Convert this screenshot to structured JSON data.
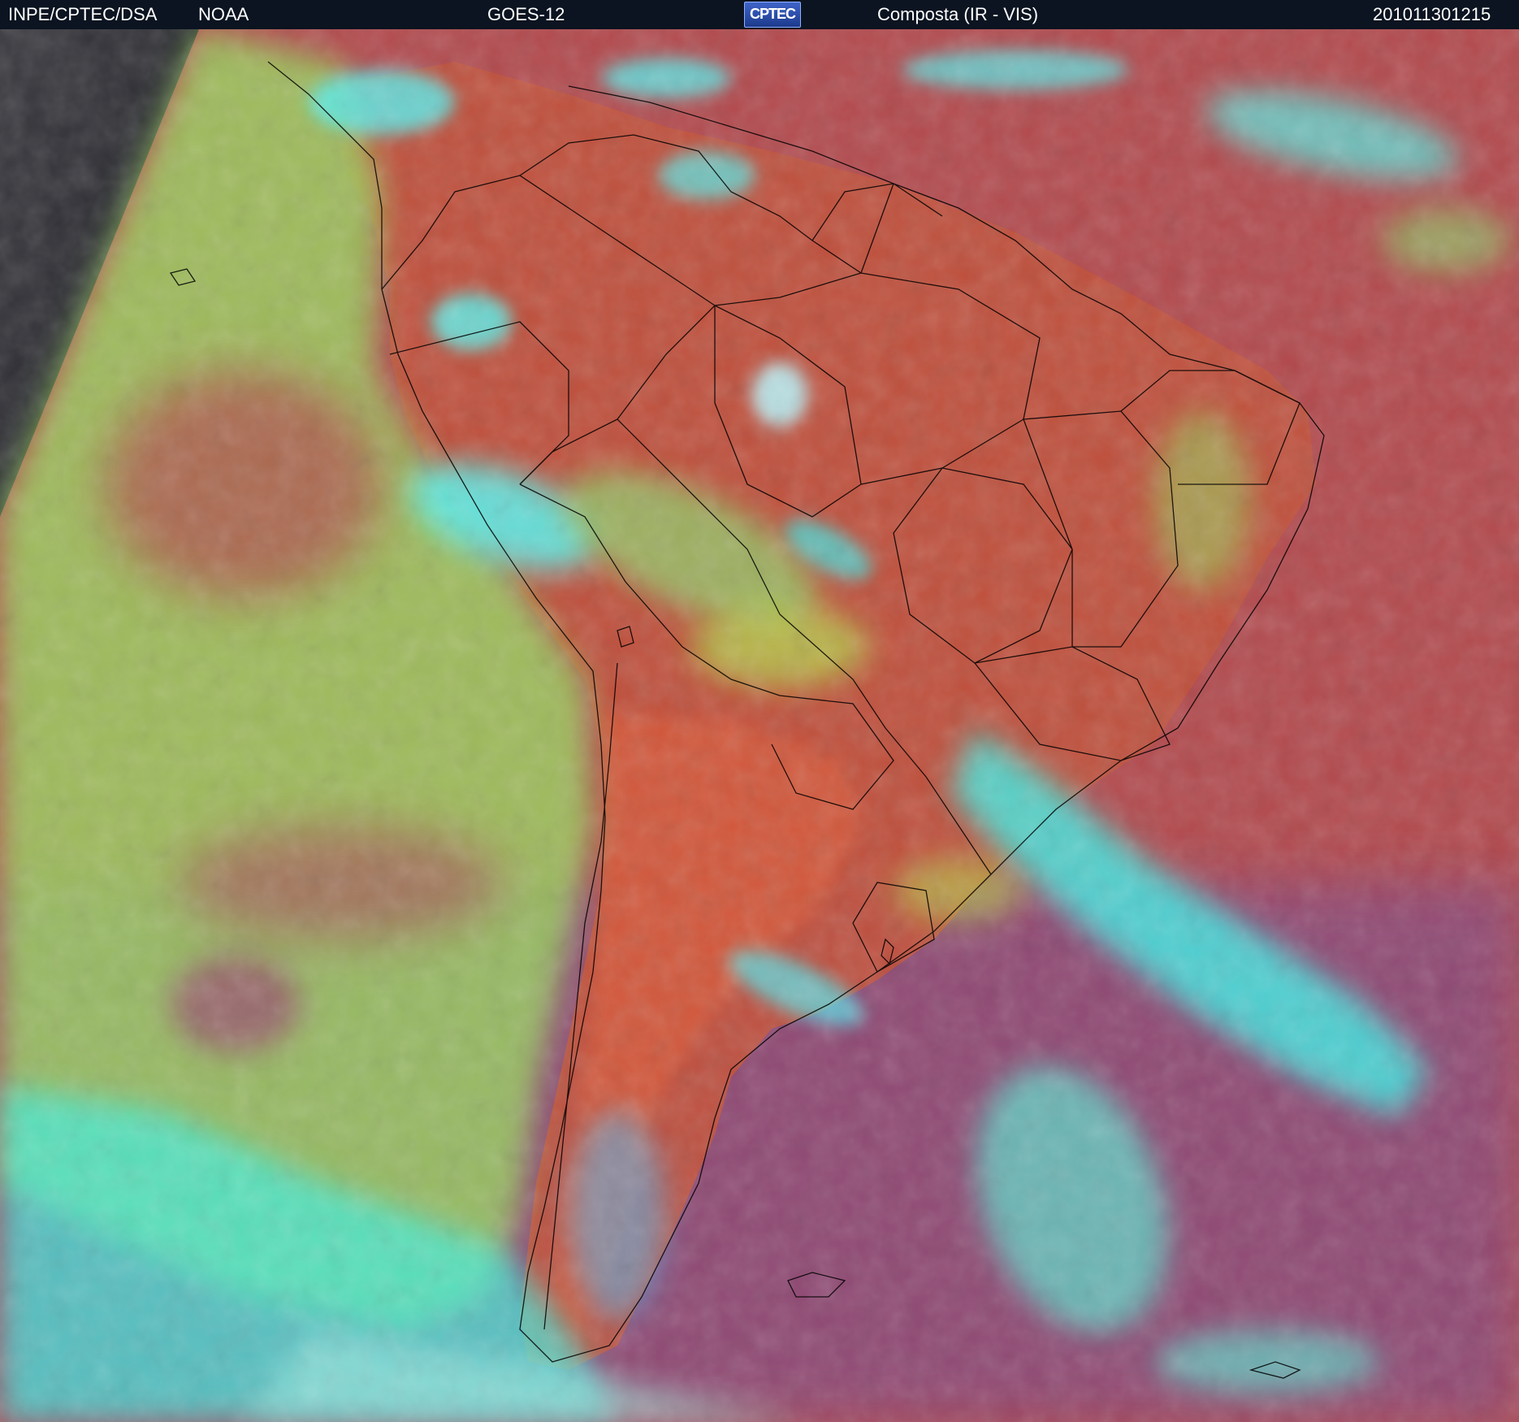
{
  "header": {
    "agency": "INPE/CPTEC/DSA",
    "source": "NOAA",
    "satellite": "GOES-12",
    "logo_text": "CPTEC",
    "product": "Composta (IR - VIS)",
    "timestamp": "201011301215"
  },
  "colors": {
    "header_background": "#0b1420",
    "header_text": "#ffffff",
    "ocean_warm": "#b24a4e",
    "land_warm": "#c9573a",
    "low_cloud": "#9ad660",
    "high_cloud": "#3ff0f0",
    "mid_cloud": "#8a5aa0",
    "space_dark": "#2a2a30",
    "border_lines": "#000000"
  },
  "icons": {
    "logo": "cptec-logo-icon"
  }
}
